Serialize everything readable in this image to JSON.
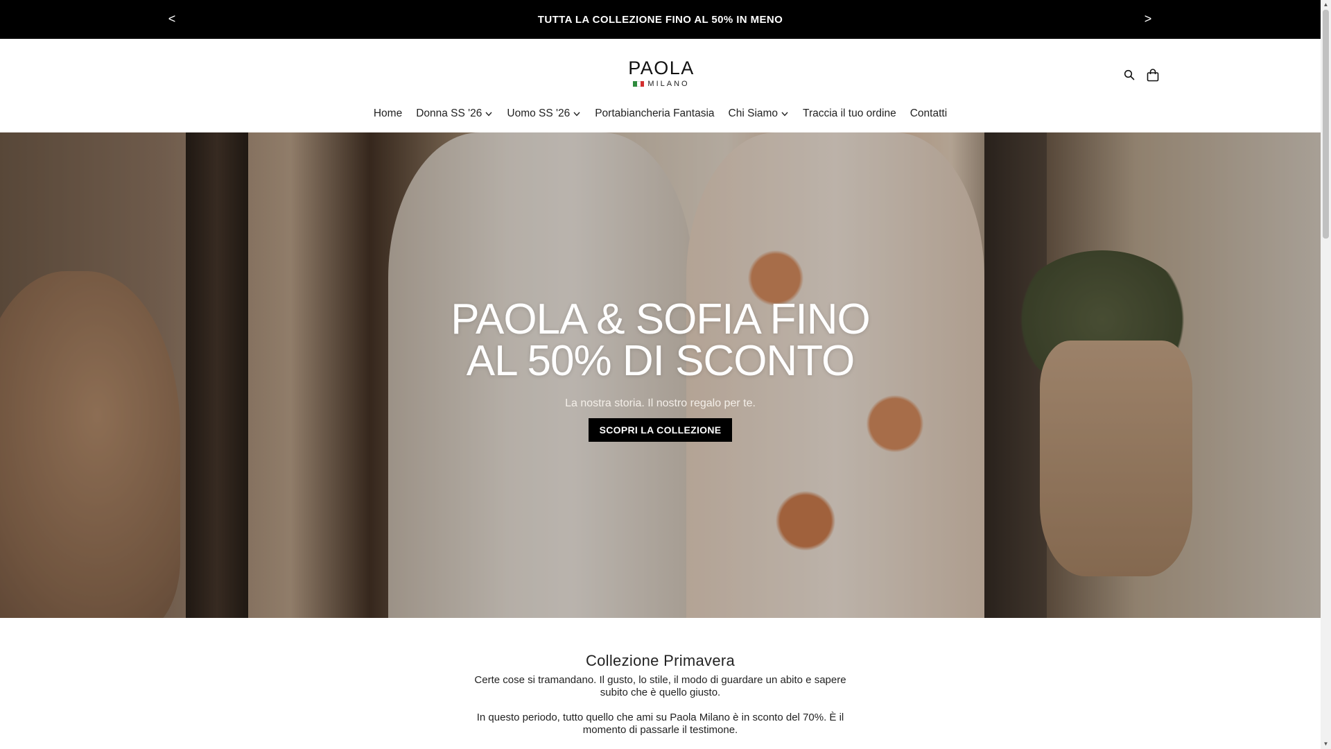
{
  "announcement": {
    "text": "TUTTA LA COLLEZIONE FINO AL 50% IN MENO",
    "prev": "<",
    "next": ">"
  },
  "logo": {
    "main": "PAOLA",
    "sub": "MILANO",
    "flag_colors": [
      "#2e8b3d",
      "#ffffff",
      "#d32f2f"
    ]
  },
  "header_icons": [
    "search-icon",
    "cart-icon"
  ],
  "nav": {
    "items": [
      {
        "label": "Home",
        "dropdown": false
      },
      {
        "label": "Donna SS '26",
        "dropdown": true
      },
      {
        "label": "Uomo SS '26",
        "dropdown": true
      },
      {
        "label": "Portabiancheria Fantasia",
        "dropdown": false
      },
      {
        "label": "Chi Siamo",
        "dropdown": true
      },
      {
        "label": "Traccia il tuo ordine",
        "dropdown": false
      },
      {
        "label": "Contatti",
        "dropdown": false
      }
    ]
  },
  "hero": {
    "title_line1": "PAOLA & SOFIA FINO",
    "title_line2": "AL 50% DI SCONTO",
    "subtitle": "La nostra storia. Il nostro regalo per te.",
    "cta": "SCOPRI LA COLLEZIONE"
  },
  "collection": {
    "title": "Collezione Primavera",
    "paragraph1": "Certe cose si tramandano. Il gusto, lo stile, il modo di guardare un abito e sapere subito che è quello giusto.",
    "paragraph2": "In questo periodo, tutto quello che ami su Paola Milano è in sconto del 70%. È il momento di passarle il testimone."
  }
}
